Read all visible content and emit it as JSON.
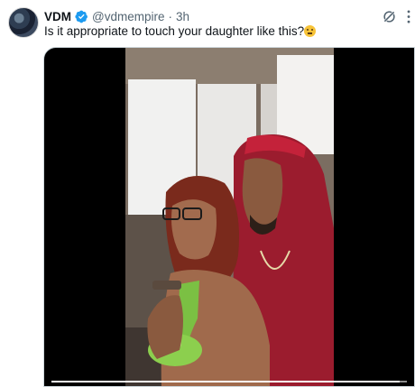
{
  "tweet": {
    "display_name": "VDM",
    "handle": "@vdmempire",
    "separator": "·",
    "time": "3h",
    "text": "Is it appropriate to touch your daughter like this?",
    "emoji": "thinking-face"
  },
  "media": {
    "type": "video",
    "progress": 0.98
  },
  "colors": {
    "verified": "#1d9bf0",
    "text": "#0f1419",
    "secondary": "#536471",
    "hoodie": "#9b1c2e"
  }
}
